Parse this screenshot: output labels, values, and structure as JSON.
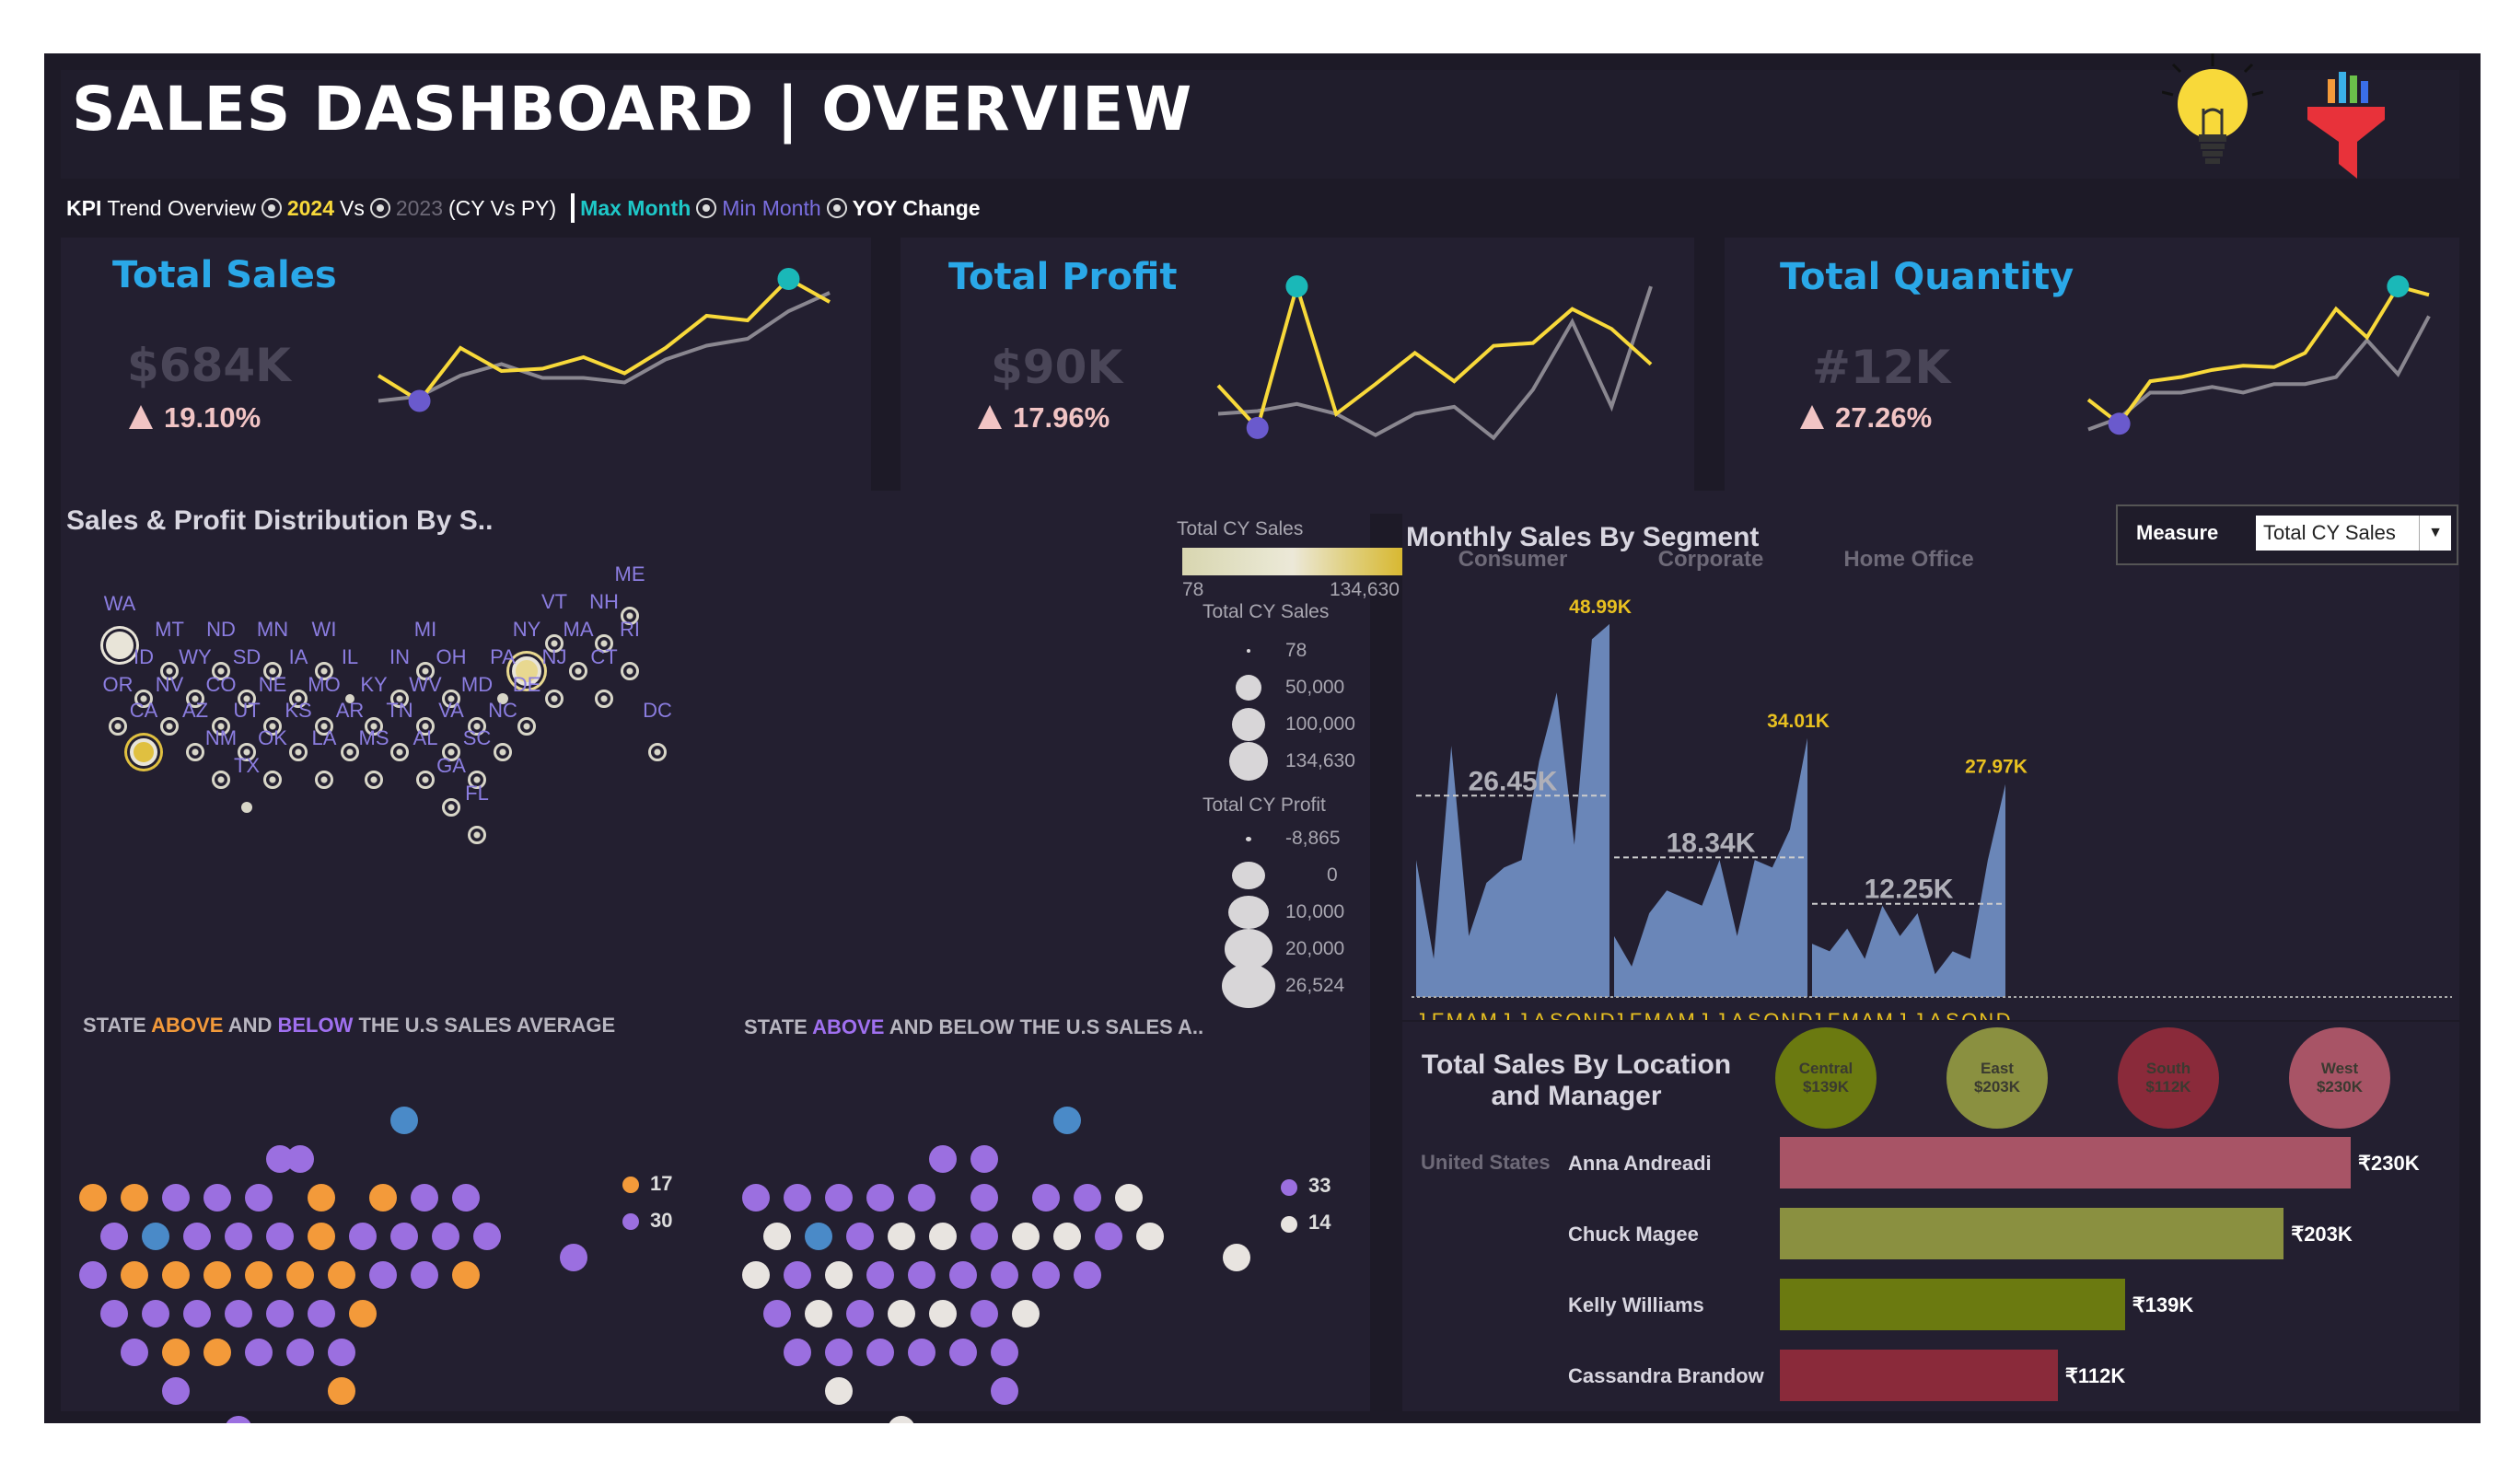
{
  "header": {
    "title": "SALES DASHBOARD | OVERVIEW",
    "icons": [
      "lightbulb-icon",
      "filter-icon"
    ]
  },
  "kpi_bar": {
    "kpi": "KPI",
    "trend_overview": "Trend Overview",
    "cy": "2024",
    "vs": "Vs",
    "py": "2023",
    "cy_vs_py": "(CY Vs PY)",
    "max_month": "Max Month",
    "min_month": "Min Month",
    "yoy": "YOY Change"
  },
  "kpis": [
    {
      "title": "Total Sales",
      "value": "$684K",
      "change": "19.10%"
    },
    {
      "title": "Total Profit",
      "value": "$90K",
      "change": "17.96%"
    },
    {
      "title": "Total Quantity",
      "value": "#12K",
      "change": "27.26%"
    }
  ],
  "map_section": {
    "title": "Sales & Profit Distribution By S..",
    "legend_sales_title": "Total CY Sales",
    "legend_range_min": "78",
    "legend_range_max": "134,630",
    "legend_size_title": "Total CY Sales",
    "legend_size_values": [
      "78",
      "50,000",
      "100,000",
      "134,630"
    ],
    "legend_profit_title": "Total CY Profit",
    "legend_profit_values": [
      "-8,865",
      "0",
      "10,000",
      "20,000",
      "26,524"
    ],
    "states": [
      "WA",
      "MT",
      "ND",
      "MN",
      "WI",
      "MI",
      "NY",
      "VT",
      "NH",
      "ME",
      "ID",
      "WY",
      "SD",
      "IA",
      "IL",
      "IN",
      "OH",
      "PA",
      "MA",
      "RI",
      "OR",
      "NV",
      "CO",
      "NE",
      "MO",
      "KY",
      "WV",
      "MD",
      "NJ",
      "CT",
      "CA",
      "AZ",
      "UT",
      "KS",
      "AR",
      "TN",
      "VA",
      "DE",
      "NC",
      "DC",
      "NM",
      "OK",
      "LA",
      "MS",
      "AL",
      "SC",
      "TX",
      "GA",
      "FL"
    ]
  },
  "hex_left": {
    "title_pre": "STATE ",
    "title_above": "ABOVE",
    "title_mid": " AND ",
    "title_below": "BELOW",
    "title_post": " THE U.S SALES AVERAGE",
    "legend": [
      {
        "color": "#f39a3a",
        "count": "17"
      },
      {
        "color": "#9b6fe0",
        "count": "30"
      }
    ]
  },
  "hex_right": {
    "title_pre": "STATE ",
    "title_above": "ABOVE",
    "title_post": " AND BELOW THE U.S SALES A..",
    "legend": [
      {
        "color": "#9b6fe0",
        "count": "33"
      },
      {
        "color": "#e8e4e0",
        "count": "14"
      }
    ]
  },
  "segment": {
    "title": "Monthly Sales By Segment",
    "measure_label": "Measure",
    "measure_value": "Total CY Sales",
    "months": [
      "J",
      "F",
      "M",
      "A",
      "M",
      "J",
      "J",
      "A",
      "S",
      "O",
      "N",
      "D"
    ]
  },
  "location": {
    "title_line1": "Total Sales By Location",
    "title_line2": "and Manager",
    "country": "United States",
    "regions": [
      {
        "name": "Central",
        "value": "$139K",
        "color": "#6b7a10"
      },
      {
        "name": "East",
        "value": "$203K",
        "color": "#8a9040"
      },
      {
        "name": "South",
        "value": "$112K",
        "color": "#8a2a3a"
      },
      {
        "name": "West",
        "value": "$230K",
        "color": "#a85466"
      }
    ]
  },
  "chart_data": [
    {
      "type": "line",
      "title": "Total Sales",
      "x": [
        "Jan",
        "Feb",
        "Mar",
        "Apr",
        "May",
        "Jun",
        "Jul",
        "Aug",
        "Sep",
        "Oct",
        "Nov",
        "Dec"
      ],
      "series": [
        {
          "name": "2024",
          "values": [
            32,
            21,
            44,
            34,
            35,
            40,
            33,
            44,
            58,
            56,
            74,
            64
          ]
        },
        {
          "name": "2023",
          "values": [
            21,
            23,
            32,
            37,
            31,
            31,
            29,
            39,
            45,
            48,
            60,
            68
          ]
        }
      ],
      "ylim": [
        0,
        80
      ]
    },
    {
      "type": "line",
      "title": "Total Profit",
      "x": [
        "Jan",
        "Feb",
        "Mar",
        "Apr",
        "May",
        "Jun",
        "Jul",
        "Aug",
        "Sep",
        "Oct",
        "Nov",
        "Dec"
      ],
      "series": [
        {
          "name": "2024",
          "values": [
            4.5,
            1.5,
            11.5,
            2.5,
            4.6,
            6.8,
            4.8,
            7.3,
            7.5,
            9.9,
            8.5,
            6.0
          ]
        },
        {
          "name": "2023",
          "values": [
            2.5,
            2.7,
            3.2,
            2.5,
            1.0,
            2.5,
            3.0,
            0.8,
            4.2,
            9.0,
            3.0,
            11.5
          ]
        }
      ],
      "ylim": [
        0,
        13
      ]
    },
    {
      "type": "line",
      "title": "Total Quantity",
      "x": [
        "Jan",
        "Feb",
        "Mar",
        "Apr",
        "May",
        "Jun",
        "Jul",
        "Aug",
        "Sep",
        "Oct",
        "Nov",
        "Dec"
      ],
      "series": [
        {
          "name": "2024",
          "values": [
            650,
            480,
            780,
            810,
            860,
            890,
            880,
            980,
            1290,
            1090,
            1450,
            1390
          ]
        },
        {
          "name": "2023",
          "values": [
            440,
            520,
            700,
            700,
            740,
            700,
            760,
            760,
            810,
            1070,
            830,
            1240
          ]
        }
      ],
      "ylim": [
        300,
        1600
      ]
    },
    {
      "type": "area",
      "title": "Monthly Sales By Segment",
      "categories": [
        "Consumer",
        "Corporate",
        "Home Office"
      ],
      "x": [
        "J",
        "F",
        "M",
        "A",
        "M",
        "J",
        "J",
        "A",
        "S",
        "O",
        "N",
        "D"
      ],
      "series": [
        {
          "name": "Consumer",
          "values": [
            18,
            5,
            33,
            8,
            15,
            17,
            18,
            31,
            40,
            20,
            47,
            48.99
          ],
          "average": "26.45K",
          "max_label": "48.99K"
        },
        {
          "name": "Corporate",
          "values": [
            8,
            4,
            11,
            14,
            13,
            12,
            18,
            8,
            18,
            17,
            22,
            34.01
          ],
          "average": "18.34K",
          "max_label": "34.01K"
        },
        {
          "name": "Home Office",
          "values": [
            7,
            6,
            9,
            5,
            12,
            8,
            11,
            3,
            6,
            5,
            18,
            27.97,
            12
          ],
          "average": "12.25K",
          "max_label": "27.97K"
        }
      ],
      "ylim": [
        0,
        52
      ]
    },
    {
      "type": "bar",
      "title": "Total Sales By Location and Manager",
      "categories": [
        "Anna Andreadi",
        "Chuck Magee",
        "Kelly Williams",
        "Cassandra Brandow"
      ],
      "values": [
        230,
        203,
        139,
        112
      ],
      "labels": [
        "₹230K",
        "₹203K",
        "₹139K",
        "₹112K"
      ],
      "colors": [
        "#a85466",
        "#8a9040",
        "#6b7a10",
        "#8a2a3a"
      ]
    }
  ]
}
